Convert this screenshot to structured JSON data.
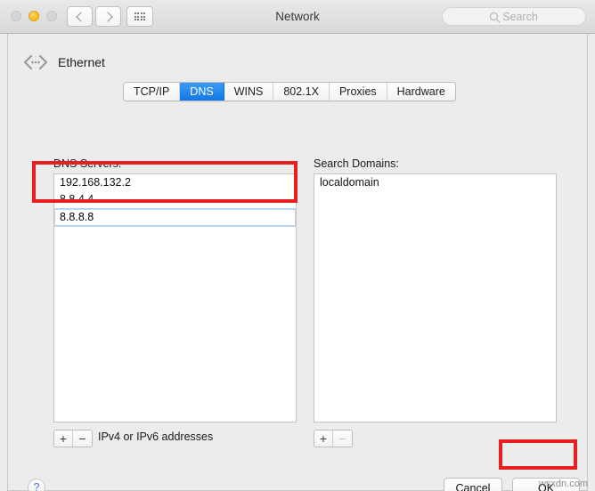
{
  "window": {
    "title": "Network",
    "traffic_lights": [
      {
        "name": "close",
        "state": "disabled"
      },
      {
        "name": "minimize",
        "state": "enabled"
      },
      {
        "name": "zoom",
        "state": "disabled"
      }
    ],
    "nav": {
      "back_icon": "chevron-left-icon",
      "forward_icon": "chevron-right-icon",
      "grid_icon": "show-all-grid-icon"
    },
    "search": {
      "placeholder": "Search",
      "value": "",
      "icon": "search-icon"
    }
  },
  "service": {
    "icon": "ethernet-icon",
    "name": "Ethernet"
  },
  "tabs": [
    {
      "label": "TCP/IP",
      "active": false
    },
    {
      "label": "DNS",
      "active": true
    },
    {
      "label": "WINS",
      "active": false
    },
    {
      "label": "802.1X",
      "active": false
    },
    {
      "label": "Proxies",
      "active": false
    },
    {
      "label": "Hardware",
      "active": false
    }
  ],
  "dns": {
    "label": "DNS Servers:",
    "servers": [
      {
        "value": "192.168.132.2",
        "selected": false,
        "editing": false
      },
      {
        "value": "8.8.4.4",
        "selected": false,
        "editing": false
      },
      {
        "value": "8.8.8.8",
        "selected": true,
        "editing": true
      }
    ],
    "add_label": "+",
    "remove_label": "−",
    "remove_disabled": false,
    "hint": "IPv4 or IPv6 addresses"
  },
  "search_domains": {
    "label": "Search Domains:",
    "domains": [
      {
        "value": "localdomain",
        "selected": false
      }
    ],
    "add_label": "+",
    "remove_label": "−",
    "remove_disabled": true
  },
  "footer": {
    "help_label": "?",
    "cancel_label": "Cancel",
    "ok_label": "OK"
  },
  "annotations": [
    {
      "name": "dns-entries-highlight",
      "color": "#e81f1f"
    },
    {
      "name": "ok-button-highlight",
      "color": "#e81f1f"
    }
  ],
  "watermark": "wsxdn.com"
}
